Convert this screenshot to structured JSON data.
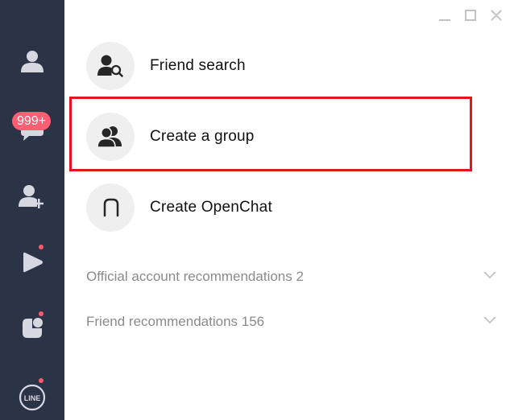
{
  "sidebar": {
    "badge": "999+",
    "items": [
      {
        "name": "friends",
        "icon": "person-icon"
      },
      {
        "name": "chats",
        "icon": "chat-bubble-icon"
      },
      {
        "name": "add-friends",
        "icon": "person-add-icon"
      },
      {
        "name": "timeline",
        "icon": "play-arrow-icon"
      },
      {
        "name": "news",
        "icon": "news-icon"
      },
      {
        "name": "line-services",
        "icon": "line-logo-icon"
      }
    ]
  },
  "window": {
    "controls": [
      "minimize-icon",
      "maximize-icon",
      "close-icon"
    ]
  },
  "menu": {
    "friend_search": "Friend search",
    "create_group": "Create a group",
    "create_openchat": "Create OpenChat"
  },
  "recommendations": {
    "official_accounts": "Official account recommendations 2",
    "friends": "Friend recommendations 156"
  },
  "colors": {
    "sidebar_bg": "#2b3346",
    "badge": "#ff5f72",
    "highlight_border": "#e8141b",
    "icon_circle": "#efefef"
  }
}
